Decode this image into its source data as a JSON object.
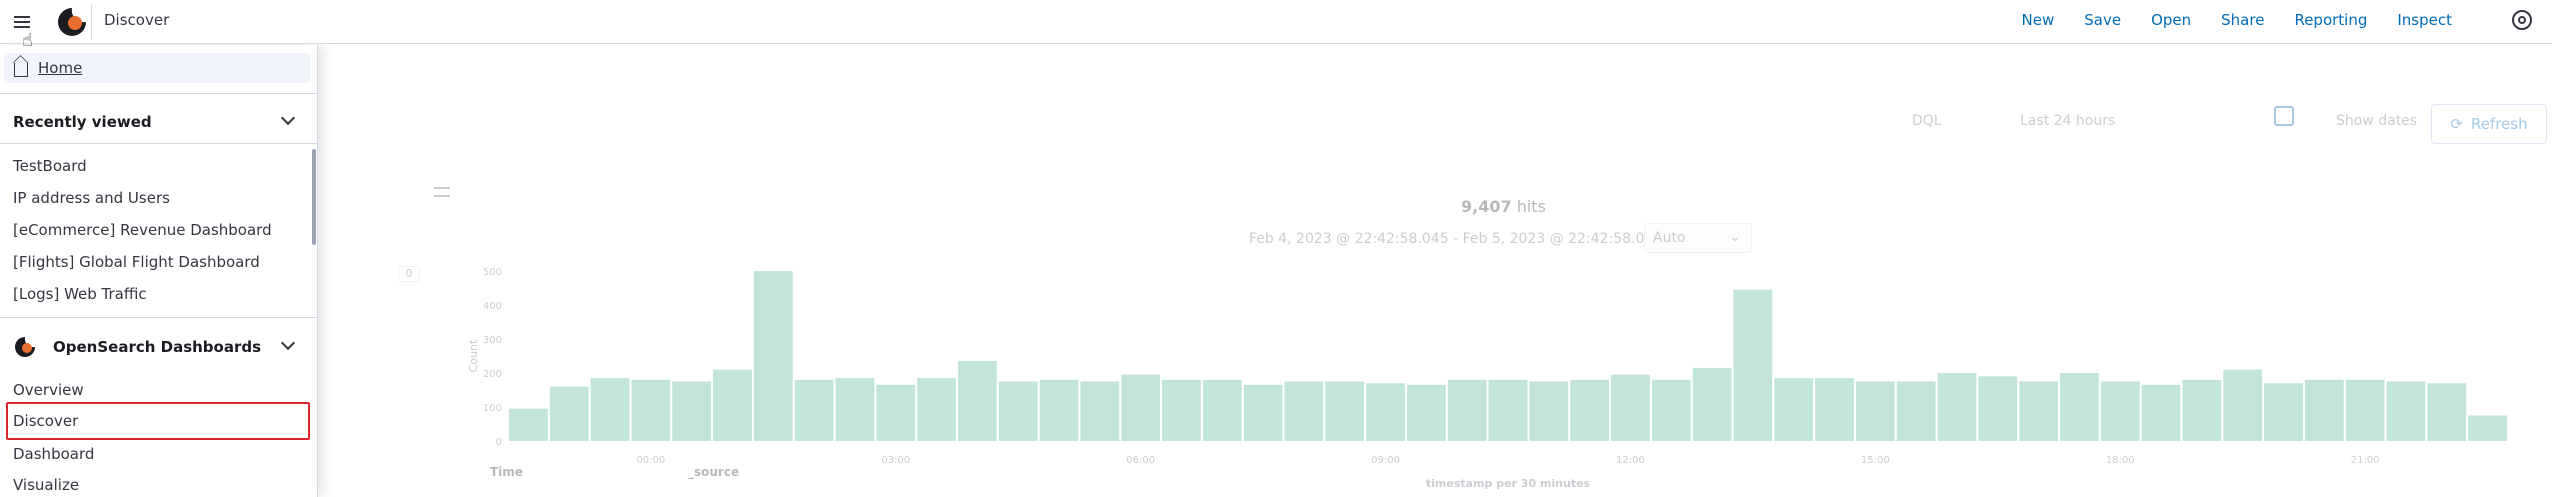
{
  "header": {
    "breadcrumb": "Discover",
    "links": [
      "New",
      "Save",
      "Open",
      "Share",
      "Reporting",
      "Inspect"
    ]
  },
  "nav": {
    "home_label": "Home",
    "recently_viewed_title": "Recently viewed",
    "recent_items": [
      "TestBoard",
      "IP address and Users",
      "[eCommerce] Revenue Dashboard",
      "[Flights] Global Flight Dashboard",
      "[Logs] Web Traffic"
    ],
    "osd_title": "OpenSearch Dashboards",
    "osd_items": [
      "Overview",
      "Discover",
      "Dashboard",
      "Visualize"
    ]
  },
  "query_bar": {
    "language": "DQL",
    "time_range": "Last 24 hours",
    "show_dates": "Show dates",
    "refresh": "Refresh"
  },
  "results": {
    "hits_count": "9,407",
    "hits_label": "hits",
    "range_text": "Feb 4, 2023 @ 22:42:58.045 - Feb 5, 2023 @ 22:42:58.045",
    "interval": "Auto",
    "zero_badge": "0",
    "table_time": "Time",
    "table_source": "_source"
  },
  "chart_data": {
    "type": "bar",
    "ylabel": "Count",
    "xlabel": "timestamp per 30 minutes",
    "y_ticks": [
      "500",
      "400",
      "300",
      "200",
      "100",
      "0"
    ],
    "x_ticks": [
      "00:00",
      "03:00",
      "06:00",
      "09:00",
      "12:00",
      "15:00",
      "18:00",
      "21:00"
    ],
    "ylim": [
      0,
      500
    ],
    "values": [
      95,
      160,
      185,
      180,
      175,
      210,
      500,
      180,
      185,
      165,
      185,
      235,
      175,
      180,
      175,
      195,
      180,
      180,
      165,
      175,
      175,
      170,
      165,
      180,
      180,
      175,
      180,
      195,
      180,
      215,
      445,
      185,
      185,
      175,
      175,
      200,
      190,
      175,
      200,
      175,
      165,
      180,
      210,
      170,
      180,
      180,
      175,
      170,
      75
    ],
    "color": "#54b399"
  },
  "colors": {
    "accent": "#006bb8",
    "highlight": "#d8262e"
  }
}
